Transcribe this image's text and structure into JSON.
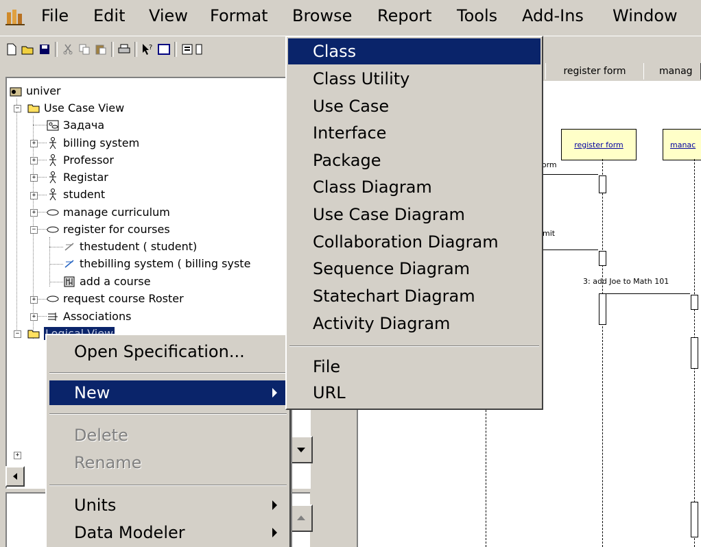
{
  "menubar": {
    "items": [
      "File",
      "Edit",
      "View",
      "Format",
      "Browse",
      "Report",
      "Tools",
      "Add-Ins",
      "Window"
    ]
  },
  "tree": {
    "root": "univer",
    "items": [
      {
        "label": "Use Case View",
        "icon": "folder-icon"
      },
      {
        "label": "Задача",
        "icon": "diagram-icon"
      },
      {
        "label": "billing system",
        "icon": "actor-icon"
      },
      {
        "label": "Professor",
        "icon": "actor-icon"
      },
      {
        "label": "Registar",
        "icon": "actor-icon"
      },
      {
        "label": "student",
        "icon": "actor-icon"
      },
      {
        "label": "manage curriculum",
        "icon": "usecase-icon"
      },
      {
        "label": "register for courses",
        "icon": "usecase-icon"
      },
      {
        "label": "thestudent ( student)",
        "icon": "association-icon"
      },
      {
        "label": "thebilling system ( billing syste",
        "icon": "association-icon"
      },
      {
        "label": "add a course",
        "icon": "sequence-icon"
      },
      {
        "label": "request course Roster",
        "icon": "usecase-icon"
      },
      {
        "label": "Associations",
        "icon": "associations-icon"
      },
      {
        "label": "Logical View",
        "icon": "folder-icon"
      }
    ]
  },
  "diagram": {
    "tabs": [
      "register form",
      "manag"
    ],
    "objects": [
      "register form",
      "manac"
    ],
    "messages": [
      "form",
      "bmit",
      "3: add  Joe to Math 101"
    ]
  },
  "context_menu": {
    "open_spec": "Open Specification...",
    "new": "New",
    "delete": "Delete",
    "rename": "Rename",
    "units": "Units",
    "data_modeler": "Data Modeler"
  },
  "submenu": {
    "items": [
      "Class",
      "Class Utility",
      "Use Case",
      "Interface",
      "Package",
      "Class Diagram",
      "Use Case Diagram",
      "Collaboration Diagram",
      "Sequence Diagram",
      "Statechart Diagram",
      "Activity Diagram"
    ],
    "extra": [
      "File",
      "URL"
    ]
  },
  "colors": {
    "highlight": "#0a246a",
    "window_bg": "#d4d0c8",
    "object_fill": "#ffffc8"
  }
}
